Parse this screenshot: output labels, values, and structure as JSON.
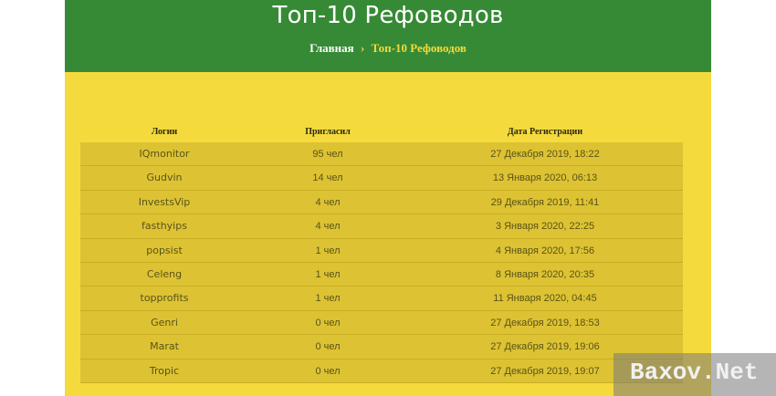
{
  "header": {
    "title": "Топ-10 Рефоводов",
    "breadcrumb": {
      "home": "Главная",
      "separator": "›",
      "current": "Топ-10 Рефоводов"
    }
  },
  "table": {
    "columns": [
      "Логин",
      "Пригласил",
      "Дата Регистрации"
    ],
    "rows": [
      {
        "login": "IQmonitor",
        "invited": "95 чел",
        "date": "27 Декабря 2019, 18:22"
      },
      {
        "login": "Gudvin",
        "invited": "14 чел",
        "date": "13 Января 2020, 06:13"
      },
      {
        "login": "InvestsVip",
        "invited": "4 чел",
        "date": "29 Декабря 2019, 11:41"
      },
      {
        "login": "fasthyips",
        "invited": "4 чел",
        "date": "3 Января 2020, 22:25"
      },
      {
        "login": "popsist",
        "invited": "1 чел",
        "date": "4 Января 2020, 17:56"
      },
      {
        "login": "Celeng",
        "invited": "1 чел",
        "date": "8 Января 2020, 20:35"
      },
      {
        "login": "topprofits",
        "invited": "1 чел",
        "date": "11 Января 2020, 04:45"
      },
      {
        "login": "Genri",
        "invited": "0 чел",
        "date": "27 Декабря 2019, 18:53"
      },
      {
        "login": "Marat",
        "invited": "0 чел",
        "date": "27 Декабря 2019, 19:06"
      },
      {
        "login": "Tropic",
        "invited": "0 чел",
        "date": "27 Декабря 2019, 19:07"
      }
    ]
  },
  "watermark": {
    "text": "Baxov.Net"
  },
  "colors": {
    "header_green": "#368a35",
    "page_yellow": "#f5da3d",
    "row_bg": "#ddc333",
    "row_text": "#5a5218"
  }
}
